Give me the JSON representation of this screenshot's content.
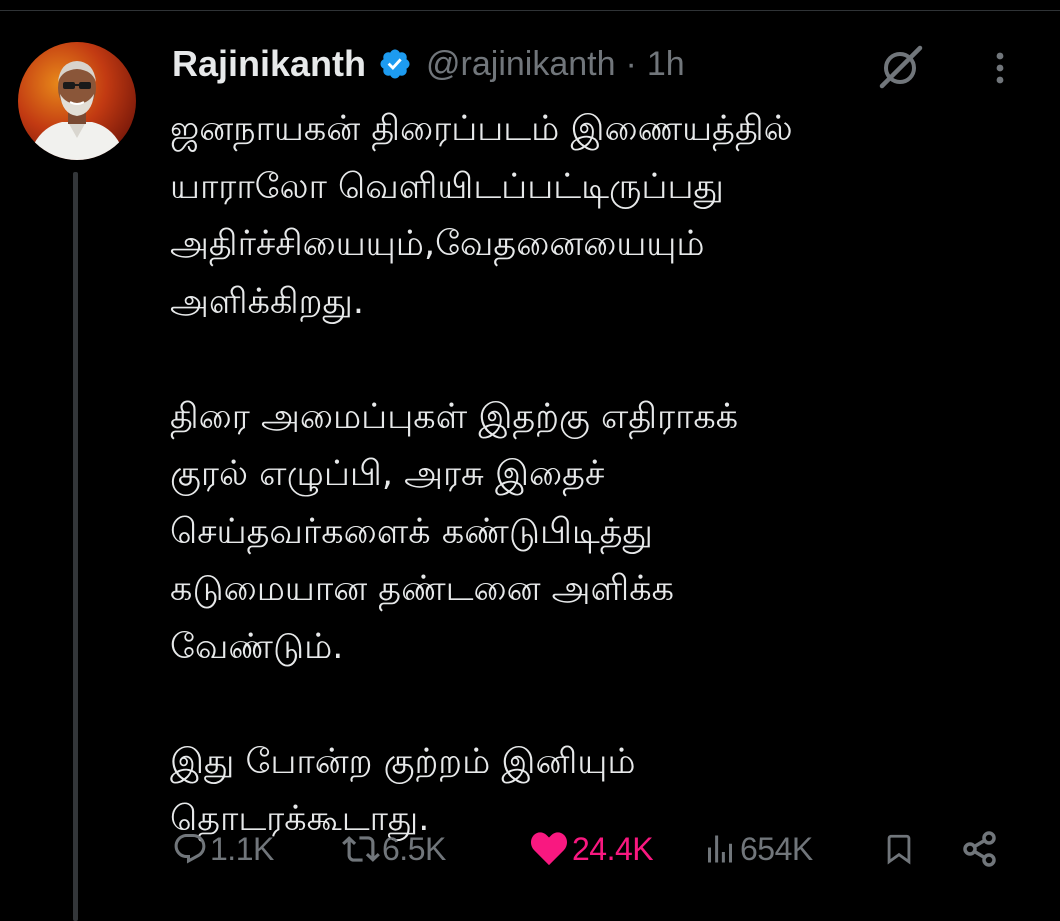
{
  "tweet": {
    "author": {
      "display_name": "Rajinikanth",
      "handle": "@rajinikanth",
      "verified": true
    },
    "dot_separator": "·",
    "time": "1h",
    "paragraphs": [
      "ஜனநாயகன் திரைப்படம் இணையத்தில்\nயாராலோ வெளியிடப்பட்டிருப்பது\nஅதிர்ச்சியையும்,வேதனையையும்\nஅளிக்கிறது.",
      "திரை அமைப்புகள் இதற்கு எதிராகக்\nகுரல் எழுப்பி, அரசு இதைச்\nசெய்தவர்களைக் கண்டுபிடித்து\nகடுமையான தண்டனை அளிக்க\nவேண்டும்.",
      "இது போன்ற குற்றம் இனியும்\nதொடரக்கூடாது."
    ],
    "actions": {
      "replies": "1.1K",
      "reposts": "6.5K",
      "likes": "24.4K",
      "views": "654K"
    },
    "icons": [
      "grok-icon",
      "more-icon",
      "reply-icon",
      "repost-icon",
      "like-icon",
      "views-icon",
      "bookmark-icon",
      "share-icon",
      "verified-icon"
    ]
  },
  "colors": {
    "background": "#000000",
    "text": "#e7e9ea",
    "muted": "#71767b",
    "verified": "#1d9bf0",
    "like": "#f91880",
    "thread_line": "#333639"
  }
}
